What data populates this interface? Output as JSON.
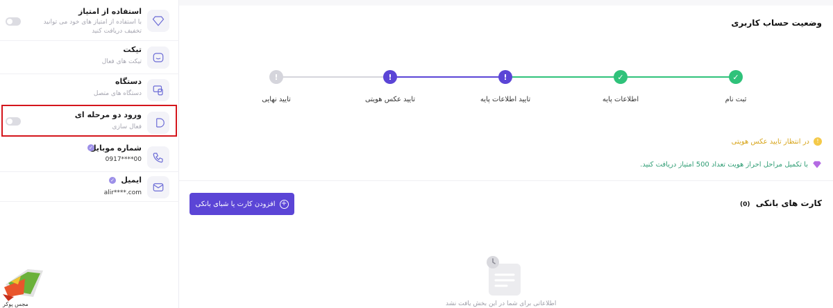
{
  "sidebar": {
    "items": [
      {
        "title": "استفاده از امتیاز",
        "desc_line1": "با استفاده از امتیاز های خود می توانید",
        "desc_line2": "تخفیف دریافت کنید",
        "icon": "gem-icon"
      },
      {
        "title": "تیکت",
        "desc": "تیکت های فعال",
        "icon": "ticket-icon"
      },
      {
        "title": "دستگاه",
        "desc": "دستگاه های متصل",
        "icon": "devices-icon"
      },
      {
        "title": "ورود دو مرحله ای",
        "desc": "فعال سازی",
        "icon": "two-step-icon"
      },
      {
        "title": "شماره موبایل",
        "value": "0917****00",
        "icon": "phone-icon"
      },
      {
        "title": "ایمیل",
        "value": "alir****.com",
        "icon": "mail-icon"
      }
    ]
  },
  "logo": {
    "text": "مجس پوکر"
  },
  "main": {
    "title": "وضعیت حساب کاربری",
    "steps": [
      {
        "label": "ثبت نام",
        "status": "done",
        "glyph": "✓"
      },
      {
        "label": "اطلاعات پایه",
        "status": "done",
        "glyph": "✓"
      },
      {
        "label": "تایید اطلاعات پایه",
        "status": "pending",
        "glyph": "!"
      },
      {
        "label": "تایید عکس هویتی",
        "status": "pending",
        "glyph": "!"
      },
      {
        "label": "تایید نهایی",
        "status": "inactive",
        "glyph": "!"
      }
    ],
    "pending_note": "در انتظار تایید عکس هویتی",
    "reward_note": "با تکمیل مراحل احراز هویت تعداد 500 امتیاز دریافت کنید.",
    "cards_title": "کارت های بانکی",
    "cards_count": "(0)",
    "add_button": "افزودن کارت یا شبای بانکی",
    "empty_text": "اطلاعاتی برای شما در این بخش یافت نشد"
  },
  "colors": {
    "done": "#2fc27a",
    "pending": "#5b45d6",
    "inactive": "#d5d5dc",
    "highlight": "#d4151b",
    "accent": "#5b45d6"
  }
}
